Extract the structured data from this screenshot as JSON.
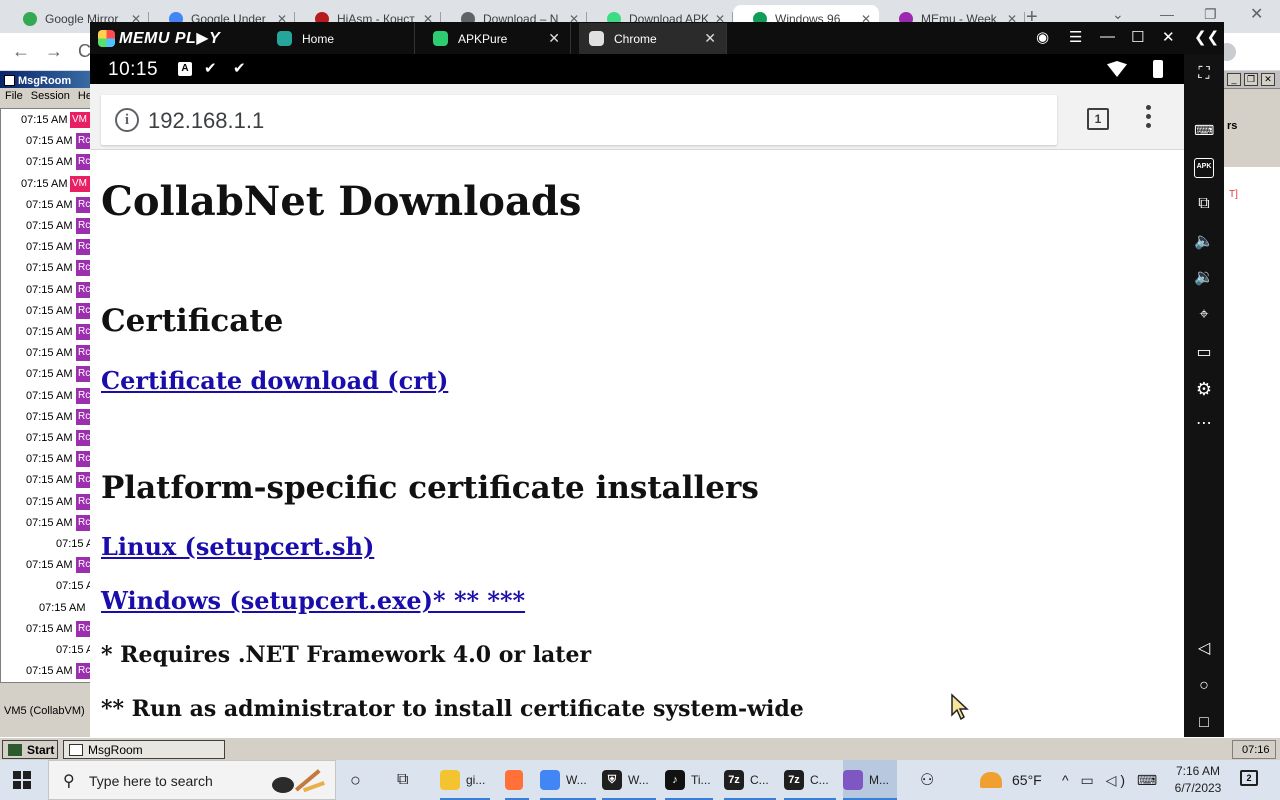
{
  "host_browser": {
    "tabs": [
      {
        "title": "Google Mirror",
        "color": "#34a853",
        "active": false
      },
      {
        "title": "Google Under",
        "color": "#4285f4",
        "active": false
      },
      {
        "title": "HiAsm - Конст",
        "color": "#b71c1c",
        "active": false
      },
      {
        "title": "Download – N",
        "color": "#5f6368",
        "active": false
      },
      {
        "title": "Download APK",
        "color": "#3ddc84",
        "active": false
      },
      {
        "title": "Windows 96",
        "color": "#0f9d58",
        "active": true
      },
      {
        "title": "MEmu - Week",
        "color": "#9c27b0",
        "active": false
      }
    ],
    "new_tab_glyph": "+"
  },
  "msgroom": {
    "title": "MsgRoom",
    "menu": [
      "File",
      "Session",
      "He"
    ],
    "rows": [
      {
        "time": "07:15 AM",
        "tag": "VM",
        "kind": "vm"
      },
      {
        "time": "07:15 AM",
        "tag": "Rc",
        "kind": "user"
      },
      {
        "time": "07:15 AM",
        "tag": "Rc",
        "kind": "user"
      },
      {
        "time": "07:15 AM",
        "tag": "VM",
        "kind": "vm"
      },
      {
        "time": "07:15 AM",
        "tag": "Rc",
        "kind": "user"
      },
      {
        "time": "07:15 AM",
        "tag": "Rc",
        "kind": "user"
      },
      {
        "time": "07:15 AM",
        "tag": "Rc",
        "kind": "user"
      },
      {
        "time": "07:15 AM",
        "tag": "Rc",
        "kind": "user"
      },
      {
        "time": "07:15 AM",
        "tag": "Rc",
        "kind": "user"
      },
      {
        "time": "07:15 AM",
        "tag": "Rc",
        "kind": "user"
      },
      {
        "time": "07:15 AM",
        "tag": "Rc",
        "kind": "user"
      },
      {
        "time": "07:15 AM",
        "tag": "Rc",
        "kind": "user"
      },
      {
        "time": "07:15 AM",
        "tag": "Rc",
        "kind": "user"
      },
      {
        "time": "07:15 AM",
        "tag": "Rc",
        "kind": "user"
      },
      {
        "time": "07:15 AM",
        "tag": "Rc",
        "kind": "user"
      },
      {
        "time": "07:15 AM",
        "tag": "Rc",
        "kind": "user"
      },
      {
        "time": "07:15 AM",
        "tag": "Rc",
        "kind": "user"
      },
      {
        "time": "07:15 AM",
        "tag": "Rc",
        "kind": "user"
      },
      {
        "time": "07:15 AM",
        "tag": "Rc",
        "kind": "user"
      },
      {
        "time": "07:15 AM",
        "tag": "Rc",
        "kind": "user"
      },
      {
        "time": "07:15 A",
        "tag": "",
        "kind": "plain"
      },
      {
        "time": "07:15 AM",
        "tag": "Rc",
        "kind": "user"
      },
      {
        "time": "07:15 A",
        "tag": "",
        "kind": "plain"
      },
      {
        "time": "07:15 AM",
        "tag": "",
        "kind": "plain"
      },
      {
        "time": "07:15 AM",
        "tag": "Rc",
        "kind": "user"
      },
      {
        "time": "07:15 A",
        "tag": "",
        "kind": "plain"
      },
      {
        "time": "07:15 AM",
        "tag": "Rc",
        "kind": "user"
      }
    ],
    "status": "VM5 (CollabVM)"
  },
  "right_window": {
    "label": "rs",
    "red_text": "T]"
  },
  "memu": {
    "logo": "MEMU PL▶Y",
    "tabs": [
      {
        "title": "Home",
        "color": "#26a69a",
        "active": false,
        "closable": false
      },
      {
        "title": "APKPure",
        "color": "#2ecc71",
        "active": false,
        "closable": true
      },
      {
        "title": "Chrome",
        "color": "#e0e0e0",
        "active": true,
        "closable": true
      }
    ],
    "controls": [
      "◉",
      "☰",
      "—",
      "☐",
      "✕",
      "❮❮"
    ],
    "sidebar_icons": [
      "fullscreen-icon",
      "keyboard-icon",
      "apk-icon",
      "multi-window-icon",
      "volume-up-icon",
      "volume-down-icon",
      "location-icon",
      "folder-icon",
      "settings-icon",
      "more-icon",
      "back-icon",
      "home-icon",
      "recents-icon"
    ],
    "sidebar_apk_label": "APK"
  },
  "android": {
    "time": "10:15",
    "status_icons": [
      "A",
      "✔",
      "✔"
    ],
    "url": "192.168.1.1",
    "tab_count": "1"
  },
  "page": {
    "title": "CollabNet Downloads",
    "h_certificate": "Certificate",
    "link_cert": "Certificate download (crt)",
    "h_installers": "Platform-specific certificate installers",
    "link_linux": "Linux (setupcert.sh)",
    "link_windows": "Windows (setupcert.exe)* ** ***",
    "note_1": "* Requires .NET Framework 4.0 or later",
    "note_2": "** Run as administrator to install certificate system-wide"
  },
  "xp_taskbar": {
    "start": "Start",
    "task": "MsgRoom",
    "clock": "07:16"
  },
  "win_taskbar": {
    "search_placeholder": "Type here to search",
    "apps": [
      {
        "label": "gi...",
        "color": "#f4c430",
        "glyph": ""
      },
      {
        "label": "",
        "color": "#ff7139",
        "glyph": ""
      },
      {
        "label": "W...",
        "color": "#4285f4",
        "glyph": ""
      },
      {
        "label": "W...",
        "color": "#1f1f1f",
        "glyph": "⛨"
      },
      {
        "label": "Ti...",
        "color": "#111111",
        "glyph": "♪"
      },
      {
        "label": "C...",
        "color": "#1f1f1f",
        "glyph": "7z"
      },
      {
        "label": "C...",
        "color": "#1f1f1f",
        "glyph": "7z"
      },
      {
        "label": "M...",
        "color": "#7e57c2",
        "glyph": ""
      }
    ],
    "weather": "65°F",
    "time": "7:16 AM",
    "date": "6/7/2023",
    "notifications": "2"
  }
}
